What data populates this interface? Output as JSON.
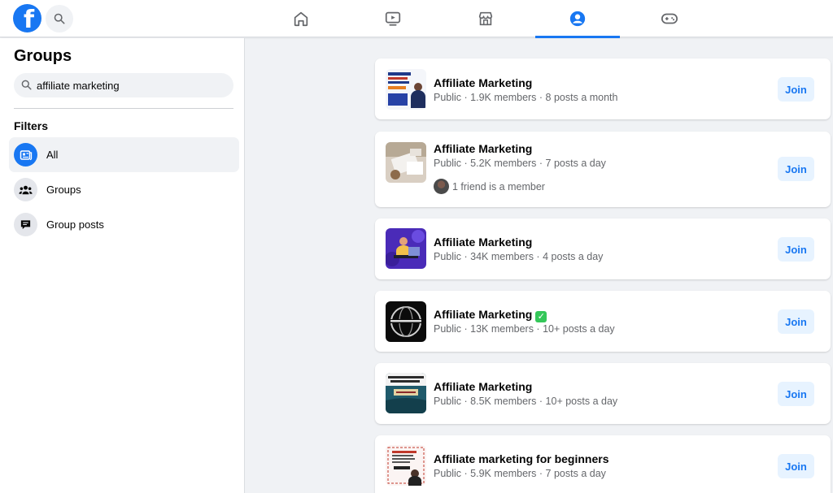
{
  "header": {
    "logo_letter": "f",
    "nav": [
      {
        "name": "home",
        "icon": "home-icon",
        "active": false
      },
      {
        "name": "watch",
        "icon": "video-play-icon",
        "active": false
      },
      {
        "name": "marketplace",
        "icon": "shop-icon",
        "active": false
      },
      {
        "name": "groups",
        "icon": "user-circle-icon",
        "active": true
      },
      {
        "name": "gaming",
        "icon": "gamepad-icon",
        "active": false
      }
    ]
  },
  "sidebar": {
    "title": "Groups",
    "search_value": "affiliate marketing",
    "filters_title": "Filters",
    "filters": [
      {
        "label": "All",
        "icon": "feed-icon",
        "active": true
      },
      {
        "label": "Groups",
        "icon": "people-icon",
        "active": false
      },
      {
        "label": "Group posts",
        "icon": "comment-icon",
        "active": false
      }
    ]
  },
  "results": [
    {
      "name": "Affiliate Marketing",
      "meta": "Public · 1.9K members · 8 posts a month",
      "verified": false,
      "friend": "",
      "join": "Join"
    },
    {
      "name": "Affiliate Marketing",
      "meta": "Public · 5.2K members · 7 posts a day",
      "verified": false,
      "friend": "1 friend is a member",
      "join": "Join"
    },
    {
      "name": "Affiliate Marketing",
      "meta": "Public · 34K members · 4 posts a day",
      "verified": false,
      "friend": "",
      "join": "Join"
    },
    {
      "name": "Affiliate Marketing",
      "meta": "Public · 13K members · 10+ posts a day",
      "verified": true,
      "friend": "",
      "join": "Join"
    },
    {
      "name": "Affiliate Marketing",
      "meta": "Public · 8.5K members · 10+ posts a day",
      "verified": false,
      "friend": "",
      "join": "Join"
    },
    {
      "name": "Affiliate marketing for beginners",
      "meta": "Public · 5.9K members · 7 posts a day",
      "verified": false,
      "friend": "",
      "join": "Join"
    }
  ],
  "colors": {
    "accent": "#1877f2",
    "join_bg": "#e7f3ff",
    "page_bg": "#f0f2f5",
    "check": "#34c759"
  }
}
